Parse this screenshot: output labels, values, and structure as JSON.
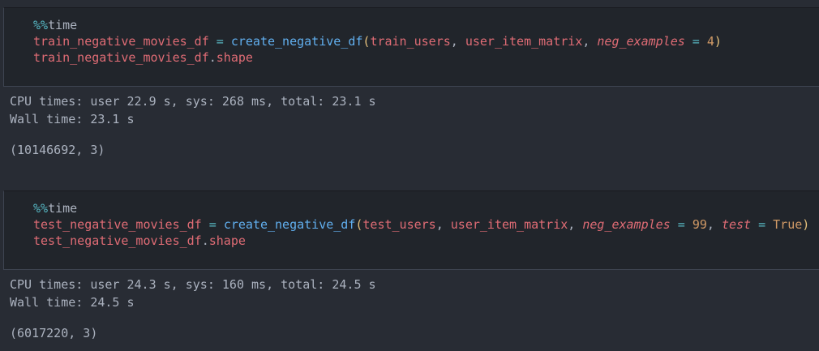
{
  "cells": [
    {
      "magic_prefix": "%%",
      "magic_name": "time",
      "line1": {
        "target": "train_negative_movies_df",
        "assign": " = ",
        "func": "create_negative_df",
        "open_paren": "(",
        "arg1": "train_users",
        "comma1": ", ",
        "arg2": "user_item_matrix",
        "comma2": ", ",
        "kw1": "neg_examples",
        "eq1": " = ",
        "val1": "4",
        "close_paren": ")"
      },
      "line2": {
        "obj": "train_negative_movies_df",
        "dot": ".",
        "attr": "shape"
      },
      "output": {
        "cpu_times": "CPU times: user 22.9 s, sys: 268 ms, total: 23.1 s",
        "wall_time": "Wall time: 23.1 s",
        "result": "(10146692, 3)"
      }
    },
    {
      "magic_prefix": "%%",
      "magic_name": "time",
      "line1": {
        "target": "test_negative_movies_df",
        "assign": " = ",
        "func": "create_negative_df",
        "open_paren": "(",
        "arg1": "test_users",
        "comma1": ", ",
        "arg2": "user_item_matrix",
        "comma2": ", ",
        "kw1": "neg_examples",
        "eq1": " = ",
        "val1": "99",
        "comma3": ", ",
        "kw2": "test",
        "eq2": " = ",
        "val2": "True",
        "close_paren": ")"
      },
      "line2": {
        "obj": "test_negative_movies_df",
        "dot": ".",
        "attr": "shape"
      },
      "output": {
        "cpu_times": "CPU times: user 24.3 s, sys: 160 ms, total: 24.5 s",
        "wall_time": "Wall time: 24.5 s",
        "result": "(6017220, 3)"
      }
    }
  ]
}
